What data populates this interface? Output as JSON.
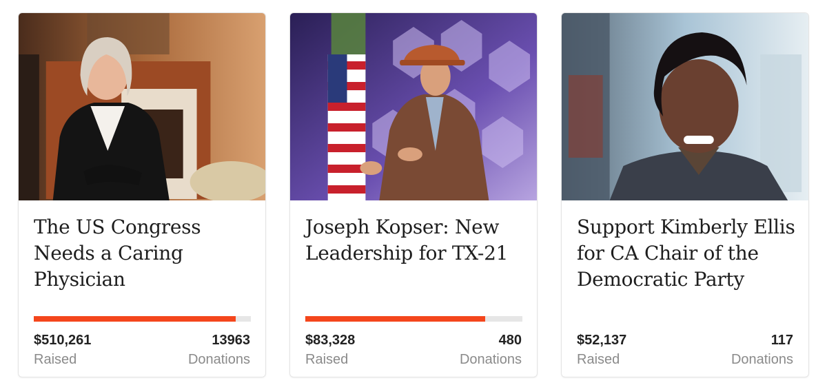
{
  "colors": {
    "accent": "#f4461c",
    "track": "#e6e6e6",
    "title": "#1e1e1e",
    "muted": "#8a8a8a"
  },
  "cards": [
    {
      "image": "photo-woman-blazer-fireplace",
      "title": "The US Congress Needs a Caring Physician",
      "progress_fraction": 0.93,
      "raised": "$510,261",
      "raised_label": "Raised",
      "donations": "13963",
      "donations_label": "Donations"
    },
    {
      "image": "photo-man-cap-speaking-stage",
      "title": "Joseph Kopser: New Leadership for TX-21",
      "progress_fraction": 0.83,
      "raised": "$83,328",
      "raised_label": "Raised",
      "donations": "480",
      "donations_label": "Donations"
    },
    {
      "image": "photo-woman-smiling-portrait",
      "title": "Support Kimberly Ellis for CA Chair of the Democratic Party",
      "progress_fraction": null,
      "raised": "$52,137",
      "raised_label": "Raised",
      "donations": "117",
      "donations_label": "Donations"
    }
  ]
}
